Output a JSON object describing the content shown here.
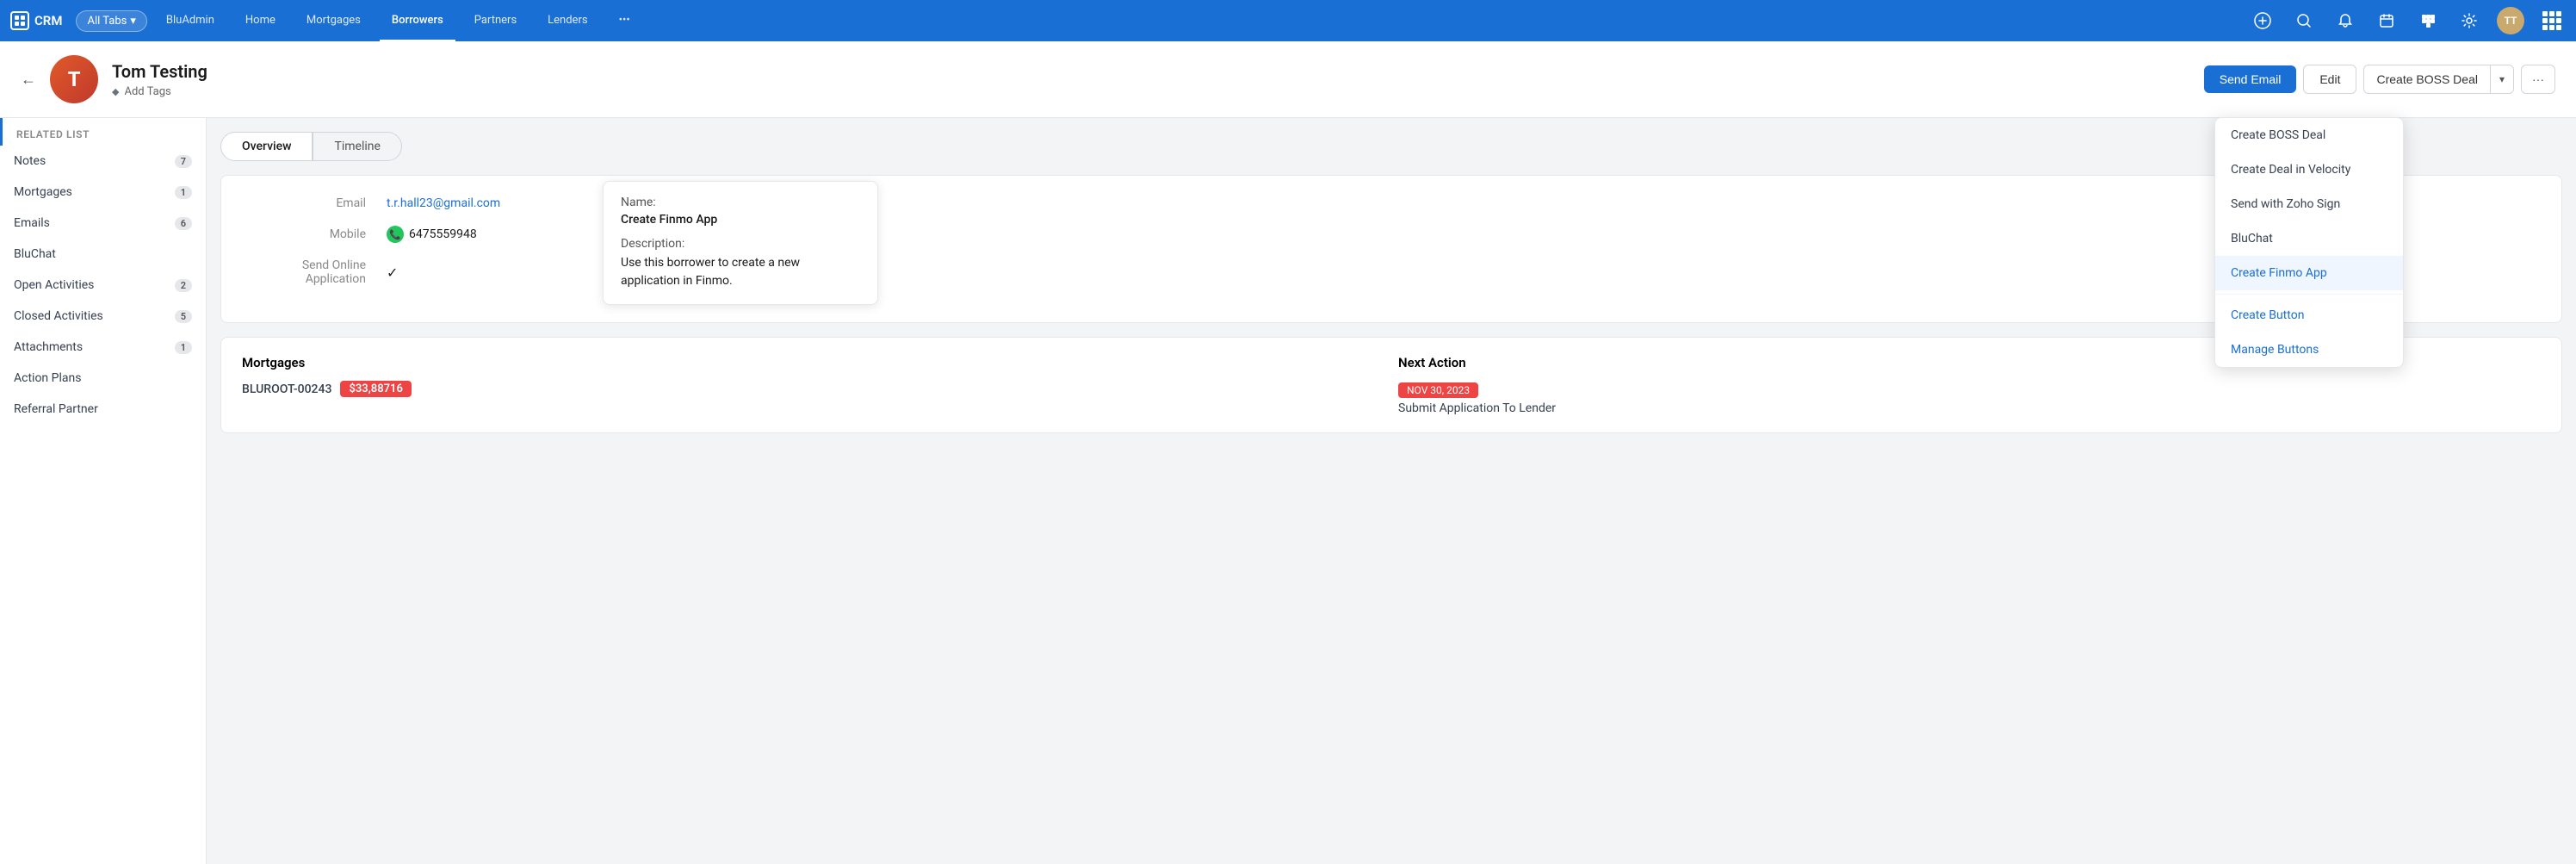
{
  "app": {
    "logo": "CRM",
    "all_tabs_label": "All Tabs"
  },
  "nav": {
    "items": [
      {
        "label": "BluAdmin",
        "active": false
      },
      {
        "label": "Home",
        "active": false
      },
      {
        "label": "Mortgages",
        "active": false
      },
      {
        "label": "Borrowers",
        "active": true
      },
      {
        "label": "Partners",
        "active": false
      },
      {
        "label": "Lenders",
        "active": false
      },
      {
        "label": "•••",
        "active": false
      }
    ]
  },
  "record": {
    "initials": "T",
    "name": "Tom Testing",
    "add_tags_label": "Add Tags",
    "back_label": "←"
  },
  "header_actions": {
    "send_email": "Send Email",
    "edit": "Edit",
    "create_boss_deal": "Create BOSS Deal",
    "more": "···"
  },
  "sidebar": {
    "section_label": "Related List",
    "items": [
      {
        "label": "Notes",
        "badge": "7"
      },
      {
        "label": "Mortgages",
        "badge": "1"
      },
      {
        "label": "Emails",
        "badge": "6"
      },
      {
        "label": "BluChat",
        "badge": ""
      },
      {
        "label": "Open Activities",
        "badge": "2"
      },
      {
        "label": "Closed Activities",
        "badge": "5"
      },
      {
        "label": "Attachments",
        "badge": "1"
      },
      {
        "label": "Action Plans",
        "badge": ""
      },
      {
        "label": "Referral Partner",
        "badge": ""
      }
    ]
  },
  "tabs": {
    "overview": "Overview",
    "timeline": "Timeline"
  },
  "fields": {
    "email_label": "Email",
    "email_value": "t.r.hall23@gmail.com",
    "mobile_label": "Mobile",
    "mobile_value": "6475559948",
    "send_online_label": "Send Online Application",
    "send_online_value": "✓"
  },
  "tooltip": {
    "name_label": "Name:",
    "name_value": "Create Finmo App",
    "desc_label": "Description:",
    "desc_value": "Use this borrower to create a new application in Finmo."
  },
  "mortgages_section": {
    "title": "Mortgages",
    "mortgage_id": "BLUROOT-00243",
    "mortgage_amount": "$33,88716",
    "next_action_title": "Next Action",
    "next_action_date": "NOV 30, 2023",
    "next_action_text": "Submit Application To Lender"
  },
  "dropdown": {
    "items": [
      {
        "label": "Create BOSS Deal",
        "active": false,
        "blue": false
      },
      {
        "label": "Create Deal in Velocity",
        "active": false,
        "blue": false
      },
      {
        "label": "Send with Zoho Sign",
        "active": false,
        "blue": false
      },
      {
        "label": "BluChat",
        "active": false,
        "blue": false
      },
      {
        "label": "Create Finmo App",
        "active": true,
        "blue": false
      }
    ],
    "footer_items": [
      {
        "label": "Create Button",
        "blue": true
      },
      {
        "label": "Manage Buttons",
        "blue": true
      }
    ]
  },
  "icons": {
    "back": "←",
    "diamond": "◆",
    "chevron_down": "▾",
    "phone": "📞",
    "checkmark": "✓",
    "search": "🔍",
    "bell": "🔔",
    "calendar": "📅",
    "settings": "⚙",
    "plus": "+"
  }
}
